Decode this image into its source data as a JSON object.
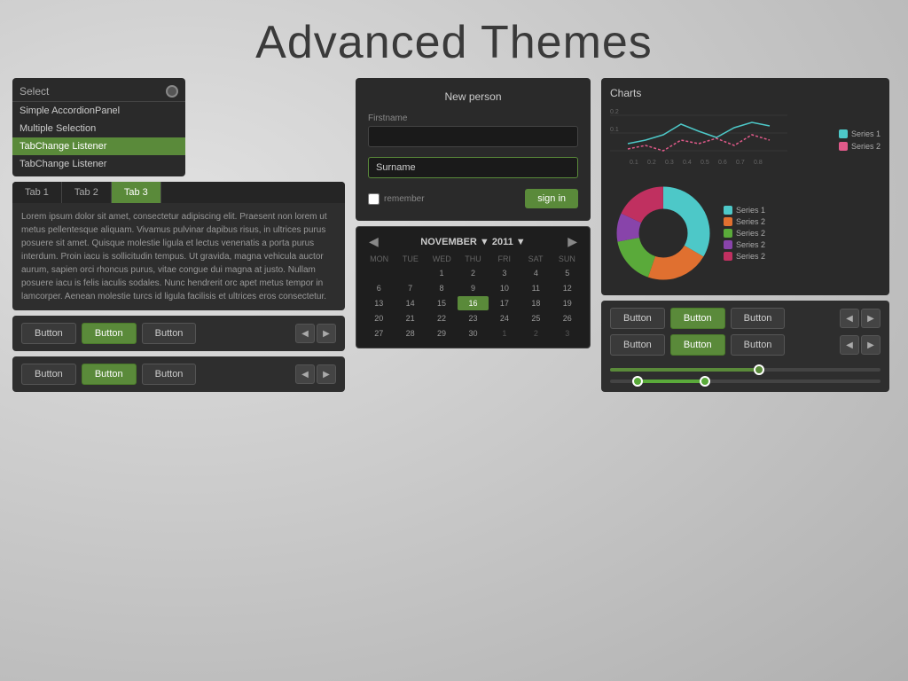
{
  "title": "Advanced Themes",
  "panel1": {
    "select": {
      "label": "Select",
      "items": [
        {
          "label": "Simple AccordionPanel",
          "active": false
        },
        {
          "label": "Multiple Selection",
          "active": false
        },
        {
          "label": "TabChange Listener",
          "active": true
        },
        {
          "label": "TabChange Listener",
          "active": false
        }
      ]
    },
    "tabs": {
      "tabs": [
        "Tab 1",
        "Tab 2",
        "Tab 3"
      ],
      "active": 2,
      "content": "Lorem ipsum dolor sit amet, consectetur adipiscing elit. Praesent non lorem ut metus pellentesque aliquam. Vivamus pulvinar dapibus risus, in ultrices purus posuere sit amet. Quisque molestie ligula et lectus venenatis a porta purus interdum. Proin iacu is sollicitudin tempus. Ut gravida, magna vehicula auctor aurum, sapien orci rhoncus purus, vitae congue dui magna at justo. Nullam posuere iacu is felis iaculis sodales. Nunc hendrerit orc apet metus tempor in lamcorper. Aenean molestie turcs id ligula facilisis et ultrices eros consectetur."
    },
    "button_rows": [
      {
        "buttons": [
          "Button",
          "Button",
          "Button"
        ],
        "active": [
          false,
          true,
          false
        ]
      },
      {
        "buttons": [
          "Button",
          "Button",
          "Button"
        ],
        "active": [
          false,
          true,
          false
        ]
      }
    ]
  },
  "panel2": {
    "form": {
      "title": "New person",
      "firstname_label": "Firstname",
      "firstname_value": "",
      "surname_label": "Surname",
      "surname_value": "Surname",
      "remember_label": "remember",
      "signin_label": "sign in"
    },
    "calendar": {
      "month": "NOVEMBER",
      "year": "2011",
      "days_header": [
        "MON",
        "TUE",
        "WED",
        "THU",
        "FRI",
        "SAT",
        "SUN"
      ],
      "weeks": [
        [
          "",
          "",
          "1",
          "2",
          "3",
          "4",
          "5"
        ],
        [
          "6",
          "7",
          "8",
          "9",
          "10",
          "11",
          "12"
        ],
        [
          "13",
          "14",
          "15",
          "16",
          "17",
          "18",
          "19"
        ],
        [
          "20",
          "21",
          "22",
          "23",
          "24",
          "25",
          "26"
        ],
        [
          "27",
          "28",
          "29",
          "30",
          "1",
          "2",
          "3"
        ]
      ],
      "today": "16"
    }
  },
  "panel3": {
    "charts": {
      "title": "Charts",
      "line_legend": [
        "Series 1",
        "Series 2"
      ],
      "line_colors": [
        "#4dc8c8",
        "#e05a8a"
      ],
      "donut_legend": [
        "Series 1",
        "Series 2",
        "Series 2",
        "Series 2",
        "Series 2"
      ],
      "donut_colors": [
        "#4dc8c8",
        "#e07030",
        "#5aaa3a",
        "#8844aa",
        "#c03060"
      ]
    },
    "buttons": [
      {
        "buttons": [
          "Button",
          "Button",
          "Button"
        ],
        "active": [
          false,
          true,
          false
        ]
      },
      {
        "buttons": [
          "Button",
          "Button",
          "Button"
        ],
        "active": [
          false,
          true,
          false
        ]
      }
    ],
    "sliders": {
      "slider1_pct": 55,
      "slider2_start": 10,
      "slider2_width": 25
    }
  }
}
